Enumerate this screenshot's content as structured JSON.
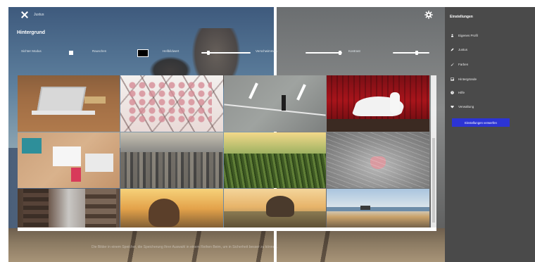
{
  "header": {
    "close_label": "Justus"
  },
  "panel": {
    "title": "Hintergrund",
    "controls": [
      {
        "label": "Sichter Modus"
      },
      {
        "label": "Rauschen"
      },
      {
        "label": "Hellbildwert"
      },
      {
        "label": "Verschwimmen"
      },
      {
        "label": "Kontrast"
      }
    ]
  },
  "gallery": {
    "items": [
      {
        "name": "laptop-desk"
      },
      {
        "name": "blossom-branches"
      },
      {
        "name": "road-runner"
      },
      {
        "name": "red-curtain-shoes"
      },
      {
        "name": "craft-desk"
      },
      {
        "name": "city-skyline"
      },
      {
        "name": "grass-field"
      },
      {
        "name": "cat-face"
      },
      {
        "name": "street-buildings"
      },
      {
        "name": "sunset-portrait"
      },
      {
        "name": "sunset-hills"
      },
      {
        "name": "lake-landscape"
      }
    ]
  },
  "footer": {
    "text": "Die Bilder in einem Speicher, die Speicherung Ihrer Auswahl in einem Reihen Beim, um in Sicherheit besser zu können."
  },
  "sidebar": {
    "title": "Einstellungen",
    "items": [
      {
        "label": "Eigenes Profil",
        "icon": "person-icon"
      },
      {
        "label": "Justus",
        "icon": "pencil-icon"
      },
      {
        "label": "Farben",
        "icon": "brush-icon"
      },
      {
        "label": "Hintergründe",
        "icon": "image-icon"
      },
      {
        "label": "Hilfe",
        "icon": "help-icon"
      },
      {
        "label": "Verwaltung",
        "icon": "heart-icon"
      }
    ],
    "button_label": "Einstellungen verwerfen"
  },
  "colors": {
    "sidebar_bg": "#4a4a4a",
    "accent_button": "#2c34d4"
  }
}
